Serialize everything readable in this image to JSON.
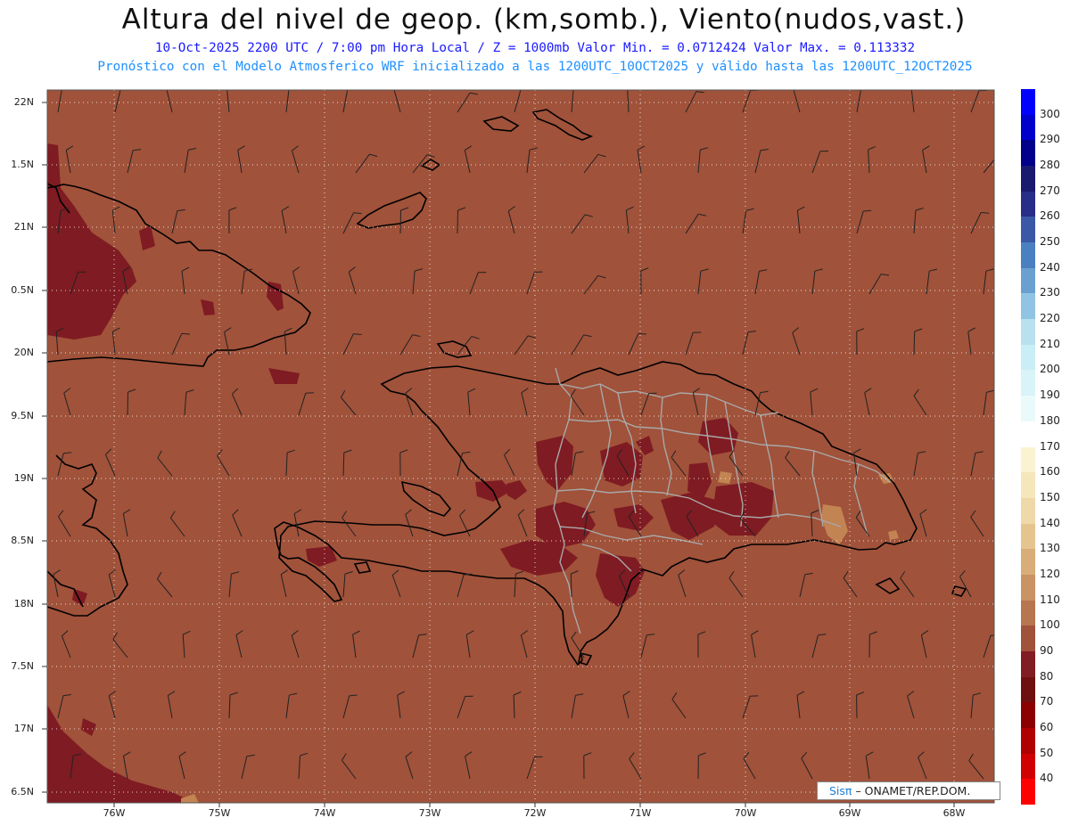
{
  "header": {
    "title": "Altura del nivel de geop. (km,somb.), Viento(nudos,vast.)",
    "subtitle1": "10-Oct-2025  2200 UTC / 7:00 pm Hora Local / Z = 1000mb  Valor Min. = 0.0712424  Valor Max. = 0.113332",
    "subtitle2": "Pronóstico con el Modelo Atmosferico WRF inicializado a las 1200UTC_10OCT2025 y válido hasta las  1200UTC_12OCT2025"
  },
  "map": {
    "lat_labels": [
      "22N",
      "1.5N",
      "21N",
      "0.5N",
      "20N",
      "9.5N",
      "19N",
      "8.5N",
      "18N",
      "7.5N",
      "17N",
      "6.5N"
    ],
    "lon_labels": [
      "76W",
      "75W",
      "74W",
      "73W",
      "72W",
      "71W",
      "70W",
      "69W",
      "68W"
    ],
    "colors": {
      "background": "#a0523a",
      "dark_region": "#7f1b22",
      "light_region": "#c28452",
      "coast": "#000000",
      "province_border": "#a8a8a8"
    }
  },
  "colorbar": {
    "labels": [
      "300",
      "290",
      "280",
      "270",
      "260",
      "250",
      "240",
      "230",
      "220",
      "210",
      "200",
      "190",
      "180",
      "170",
      "160",
      "150",
      "140",
      "130",
      "120",
      "110",
      "100",
      "90",
      "80",
      "70",
      "60",
      "50",
      "40"
    ],
    "colors": [
      "#0000ff",
      "#0000cd",
      "#00008b",
      "#191970",
      "#282d87",
      "#3a58a6",
      "#4a7fc0",
      "#6aa0d0",
      "#90c4e2",
      "#b8e0ee",
      "#c9eef5",
      "#d9f4f8",
      "#eafafb",
      "#ffffff",
      "#fbf2d2",
      "#f5e6bc",
      "#efd9a8",
      "#e6c48f",
      "#d9ad78",
      "#c99364",
      "#b77550",
      "#a0523a",
      "#821d24",
      "#6e1010",
      "#8b0000",
      "#b00000",
      "#d00000",
      "#ff0000"
    ]
  },
  "credit": {
    "brand": "Sisπ",
    "text": "– ONAMET/REP.DOM."
  }
}
